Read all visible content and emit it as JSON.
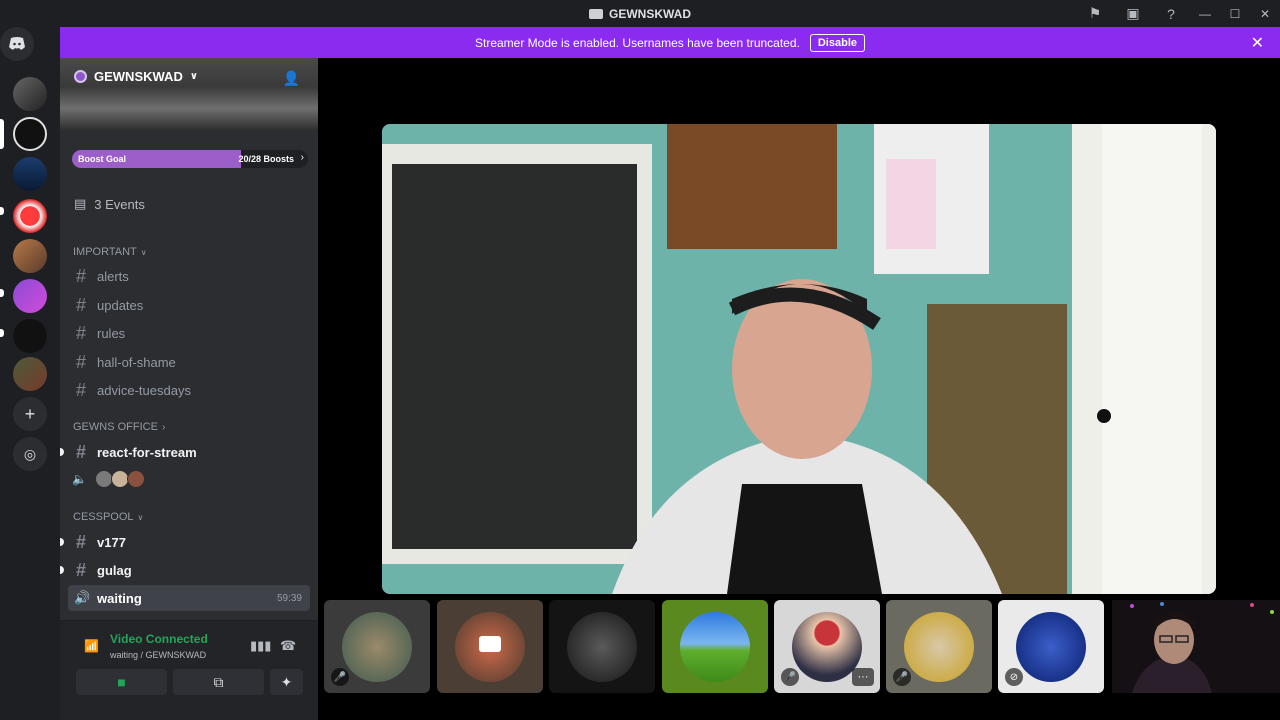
{
  "window": {
    "title": "GEWNSKWAD"
  },
  "banner": {
    "message": "Streamer Mode is enabled. Usernames have been truncated.",
    "disable_label": "Disable"
  },
  "guild": {
    "name": "GEWNSKWAD",
    "boost_label": "Boost Goal",
    "boost_count": "20/28 Boosts",
    "boost_fraction": 0.714,
    "events_label": "3 Events"
  },
  "categories": {
    "important": "IMPORTANT",
    "office": "GEWNS OFFICE",
    "cesspool": "CESSPOOL"
  },
  "channels": {
    "alerts": "alerts",
    "updates": "updates",
    "rules": "rules",
    "hall_of_shame": "hall-of-shame",
    "advice_tuesdays": "advice-tuesdays",
    "react_for_stream": "react-for-stream",
    "v177": "v177",
    "gulag": "gulag",
    "waiting": "waiting",
    "waiting_time": "59:39"
  },
  "voice": {
    "status": "Video Connected",
    "location": "waiting / GEWNSKWAD"
  },
  "colors": {
    "banner": "#8b2bf0",
    "connected": "#23a55a",
    "sidebar": "#2b2d31",
    "rail": "#1e1f22"
  }
}
